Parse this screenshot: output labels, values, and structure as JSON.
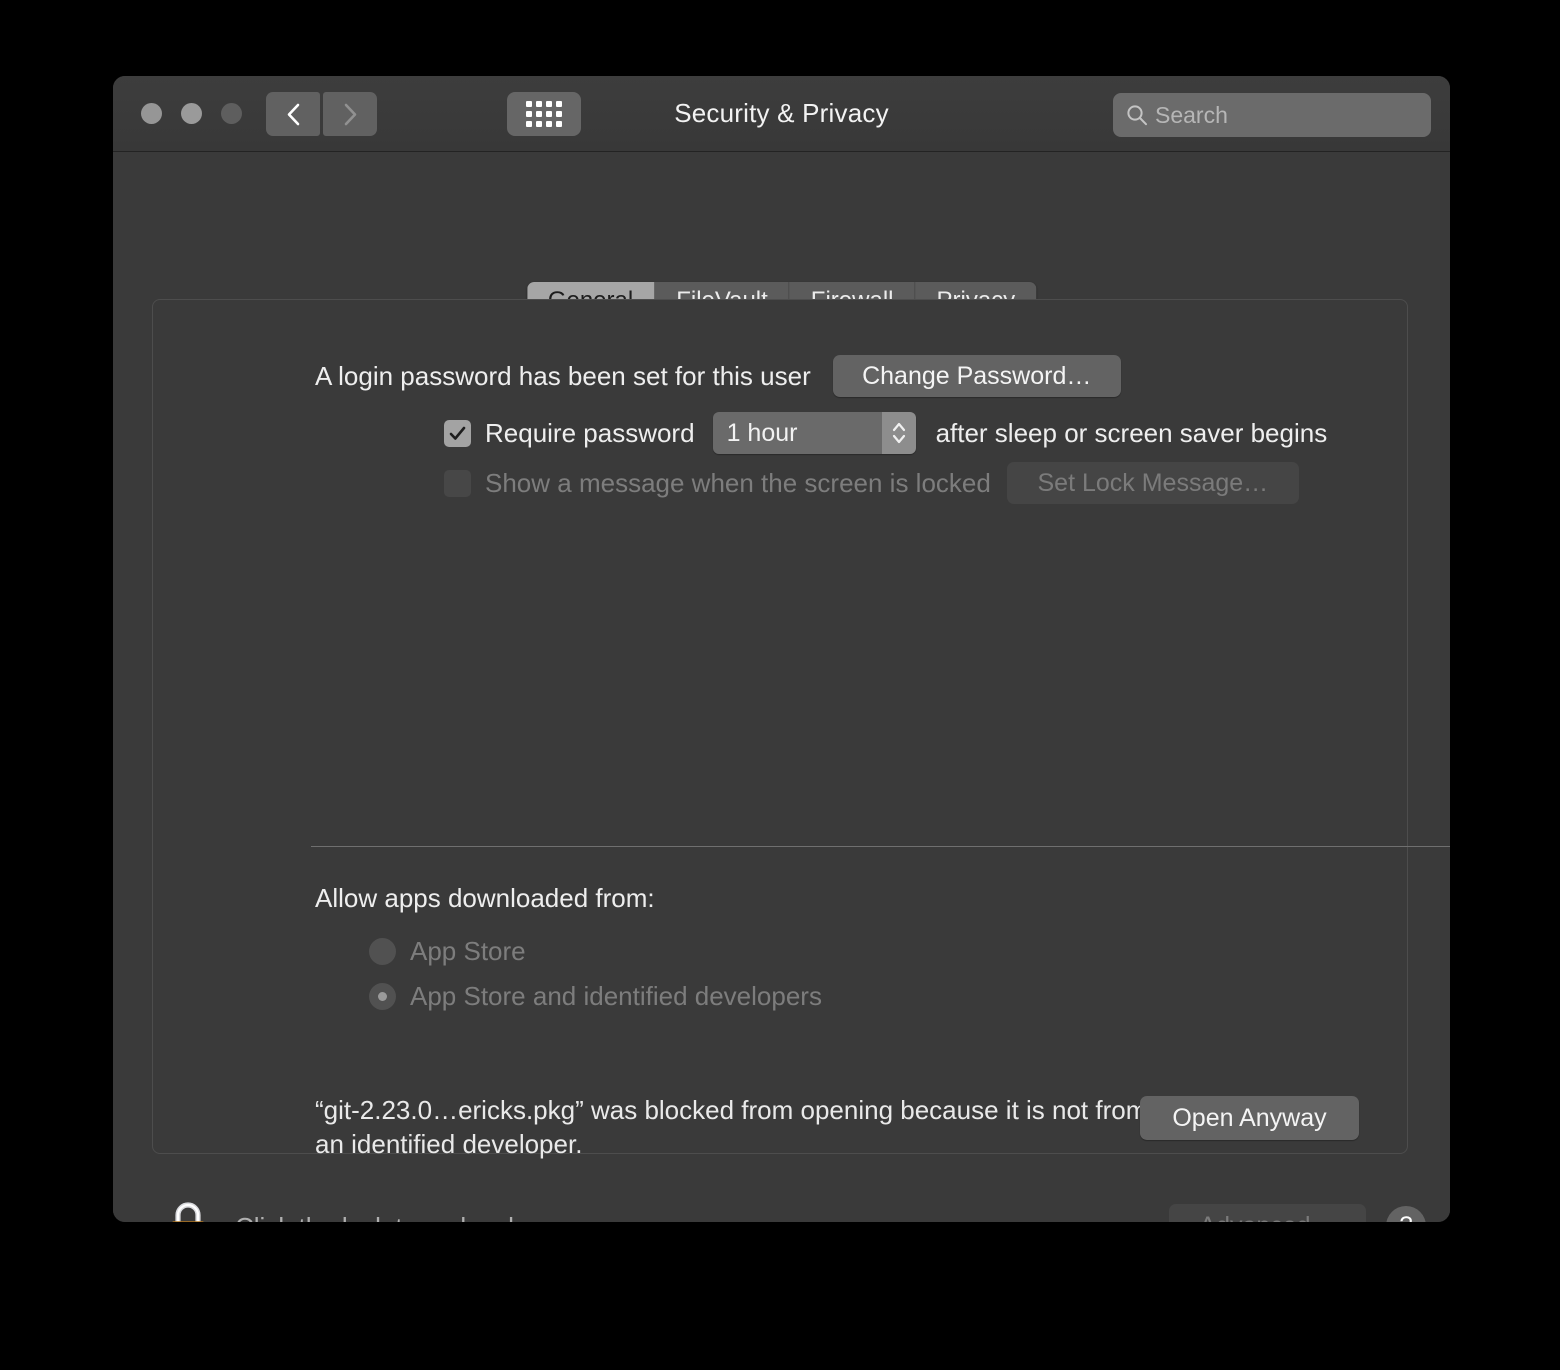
{
  "window": {
    "title": "Security & Privacy",
    "traffic_lights": [
      "close-button",
      "minimize-button",
      "zoom-button"
    ],
    "nav": {
      "back_icon": "chevron-left-icon",
      "forward_icon": "chevron-right-icon",
      "grid_icon": "grid-view-icon"
    },
    "search": {
      "placeholder": "Search",
      "value": "",
      "icon": "search-icon"
    }
  },
  "tabs": [
    {
      "label": "General",
      "active": true
    },
    {
      "label": "FileVault",
      "active": false
    },
    {
      "label": "Firewall",
      "active": false
    },
    {
      "label": "Privacy",
      "active": false
    }
  ],
  "general": {
    "login_password_text": "A login password has been set for this user",
    "change_password_label": "Change Password…",
    "require_password": {
      "label": "Require password",
      "checked": true,
      "delay_value": "1 hour",
      "suffix": "after sleep or screen saver begins"
    },
    "lock_message": {
      "label": "Show a message when the screen is locked",
      "checked": false,
      "button_label": "Set Lock Message…",
      "disabled": true
    },
    "allow_apps": {
      "heading": "Allow apps downloaded from:",
      "options": [
        {
          "label": "App Store",
          "selected": false
        },
        {
          "label": "App Store and identified developers",
          "selected": true
        }
      ],
      "disabled": true
    },
    "blocked_notice": {
      "text": "“git-2.23.0…ericks.pkg” was blocked from opening because it is not from an identified developer.",
      "button_label": "Open Anyway"
    }
  },
  "footer": {
    "lock_icon": "padlock-locked-icon",
    "lock_text": "Click the lock to make changes.",
    "advanced_label": "Advanced…",
    "advanced_disabled": true,
    "help_label": "?"
  },
  "colors": {
    "window_bg": "#3a3a3a",
    "titlebar_bg": "#3d3d3d",
    "active_tab_bg": "#a6a6a6",
    "inactive_tab_bg": "#5b5b5b",
    "button_bg": "#636363",
    "lock_gold": "#f0a838",
    "text_primary": "#eeeeee",
    "text_dim": "#7d7d7d"
  }
}
